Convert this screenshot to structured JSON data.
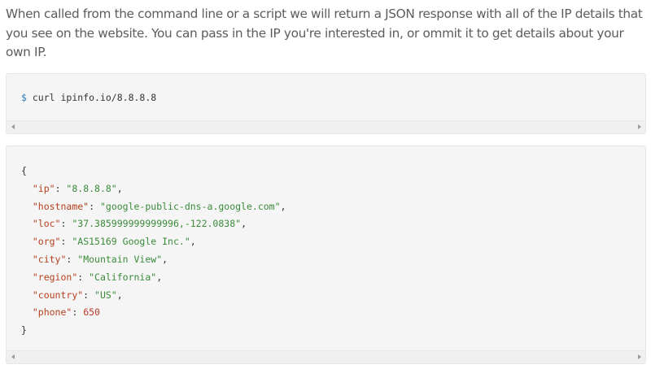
{
  "intro": {
    "text": "When called from the command line or a script we will return a JSON response with all of the IP details that you see on the website. You can pass in the IP you're interested in, or ommit it to get details about your own IP."
  },
  "command": {
    "prompt": "$",
    "text": "curl ipinfo.io/8.8.8.8"
  },
  "response": {
    "open_brace": "{",
    "close_brace": "}",
    "fields": [
      {
        "key": "\"ip\"",
        "value": "\"8.8.8.8\"",
        "type": "string",
        "trail": ","
      },
      {
        "key": "\"hostname\"",
        "value": "\"google-public-dns-a.google.com\"",
        "type": "string",
        "trail": ","
      },
      {
        "key": "\"loc\"",
        "value": "\"37.385999999999996,-122.0838\"",
        "type": "string",
        "trail": ","
      },
      {
        "key": "\"org\"",
        "value": "\"AS15169 Google Inc.\"",
        "type": "string",
        "trail": ","
      },
      {
        "key": "\"city\"",
        "value": "\"Mountain View\"",
        "type": "string",
        "trail": ","
      },
      {
        "key": "\"region\"",
        "value": "\"California\"",
        "type": "string",
        "trail": ","
      },
      {
        "key": "\"country\"",
        "value": "\"US\"",
        "type": "string",
        "trail": ","
      },
      {
        "key": "\"phone\"",
        "value": "650",
        "type": "number",
        "trail": ""
      }
    ]
  },
  "icons": {
    "scroll_left": "scroll-left-arrow-icon",
    "scroll_right": "scroll-right-arrow-icon"
  },
  "colors": {
    "prompt": "#2f7ab8",
    "json_key": "#b5401c",
    "json_string": "#3a8a3a",
    "json_number": "#c0392b",
    "code_background": "#f5f5f5"
  }
}
